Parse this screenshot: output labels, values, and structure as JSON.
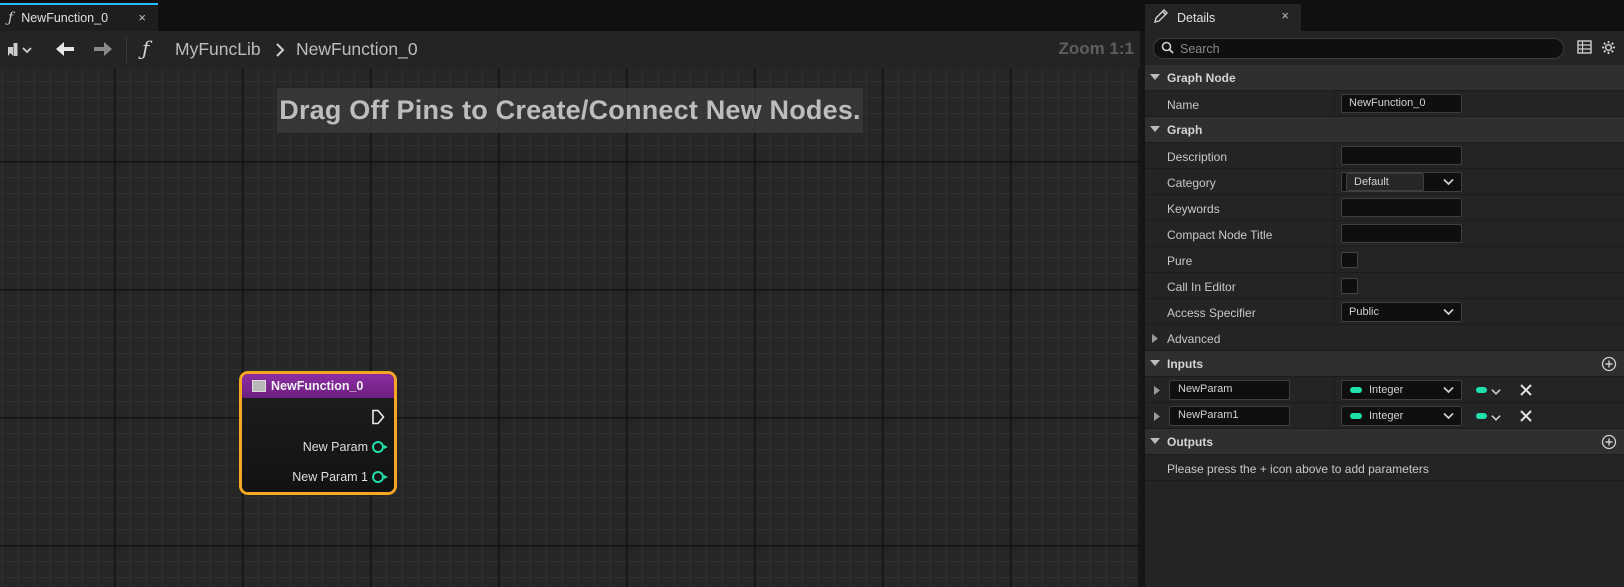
{
  "graph": {
    "tab": {
      "label": "NewFunction_0",
      "close": "×"
    },
    "breadcrumb": {
      "library": "MyFuncLib",
      "function": "NewFunction_0"
    },
    "zoom": "Zoom 1:1",
    "hint": "Drag Off Pins to Create/Connect New Nodes.",
    "node": {
      "title": "NewFunction_0",
      "params": [
        "New Param",
        "New Param 1"
      ]
    }
  },
  "details": {
    "tab": {
      "label": "Details",
      "close": "×"
    },
    "search": {
      "placeholder": "Search"
    },
    "sections": {
      "graph_node": "Graph Node",
      "graph": "Graph",
      "advanced": "Advanced",
      "inputs": "Inputs",
      "outputs": "Outputs"
    },
    "fields": {
      "name": {
        "label": "Name",
        "value": "NewFunction_0"
      },
      "description": {
        "label": "Description",
        "value": ""
      },
      "category": {
        "label": "Category",
        "value": "Default"
      },
      "keywords": {
        "label": "Keywords",
        "value": ""
      },
      "compact_title": {
        "label": "Compact Node Title",
        "value": ""
      },
      "pure": {
        "label": "Pure"
      },
      "call_in_editor": {
        "label": "Call In Editor"
      },
      "access": {
        "label": "Access Specifier",
        "value": "Public"
      }
    },
    "inputs": [
      {
        "name": "NewParam",
        "type": "Integer"
      },
      {
        "name": "NewParam1",
        "type": "Integer"
      }
    ],
    "outputs_note": "Please press the + icon above to add parameters"
  },
  "colors": {
    "accent": "#26bbff",
    "integer_pin": "#1fe0ad",
    "node_header": "#8d2ea3",
    "node_selected": "#f5a623"
  }
}
